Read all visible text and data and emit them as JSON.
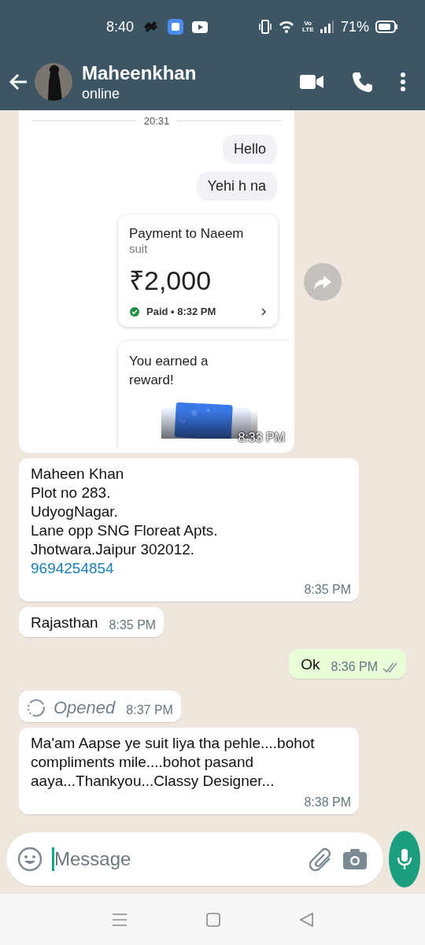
{
  "status_bar": {
    "time": "8:40",
    "network": "Vo LTE",
    "battery": "71%"
  },
  "header": {
    "name": "Maheenkhan",
    "status": "online"
  },
  "messages": [
    {
      "kind": "screenshot",
      "outgoing": false,
      "date": "20:31",
      "bubbles": [
        "Hello",
        "Yehi h na"
      ],
      "payment": {
        "title": "Payment to Naeem",
        "note": "suit",
        "amount": "₹2,000",
        "status": "Paid • 8:32 PM"
      },
      "reward": {
        "title": "You earned a reward!"
      },
      "time": "8:33 PM"
    },
    {
      "kind": "text",
      "outgoing": false,
      "text": "Maheen Khan\nPlot no 283.\nUdyogNagar.\nLane opp SNG Floreat Apts.\nJhotwara.Jaipur 302012.",
      "link": "9694254854",
      "time": "8:35 PM"
    },
    {
      "kind": "text",
      "outgoing": false,
      "text": "Rajasthan",
      "time": "8:35 PM"
    },
    {
      "kind": "text",
      "outgoing": true,
      "text": "Ok",
      "time": "8:36 PM",
      "read": false
    },
    {
      "kind": "opened",
      "outgoing": false,
      "text": "Opened",
      "time": "8:37 PM"
    },
    {
      "kind": "text",
      "outgoing": false,
      "text": "Ma'am Aapse ye suit liya tha pehle....bohot compliments mile....bohot pasand aaya...Thankyou...Classy Designer...",
      "time": "8:38 PM"
    }
  ],
  "composer": {
    "placeholder": "Message"
  }
}
